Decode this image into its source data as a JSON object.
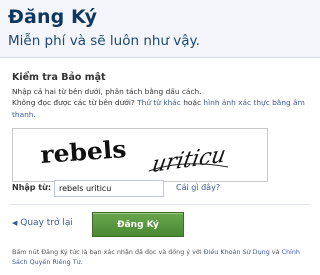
{
  "header": {
    "title": "Đăng Ký",
    "subtitle": "Miễn phí và sẽ luôn như vậy."
  },
  "security": {
    "title": "Kiểm tra Bảo mật",
    "instruction": "Nhập cả hai từ bên dưới, phân tách bằng dấu cách.",
    "cant_read": "Không đọc được các từ bên dưới?",
    "other_words_link": "Thử từ khác",
    "or": "hoặc",
    "audio_link": "hình ảnh xác thực bằng âm thanh",
    "period": "."
  },
  "captcha": {
    "word1": "rebels",
    "word2": "uriticu"
  },
  "form": {
    "input_label": "Nhập từ:",
    "input_value": "rebels uriticu",
    "help_link": "Cái gì đây?"
  },
  "actions": {
    "back_label": "Quay trở lại",
    "submit_label": "Đăng Ký"
  },
  "terms": {
    "prefix": "Bấm nút Đăng Ký tức là bạn xác nhận đã đọc và đồng ý với",
    "terms_link": "Điều Khoản Sử Dụng",
    "and": "và",
    "privacy_link": "Chính Sách Quyền Riêng Tư",
    "period": "."
  },
  "icons": {
    "back": "left-triangle-icon"
  },
  "colors": {
    "header_bg": "#f3f5fa",
    "title": "#0e385f",
    "link": "#3b5998",
    "button": "#4a8a33"
  }
}
